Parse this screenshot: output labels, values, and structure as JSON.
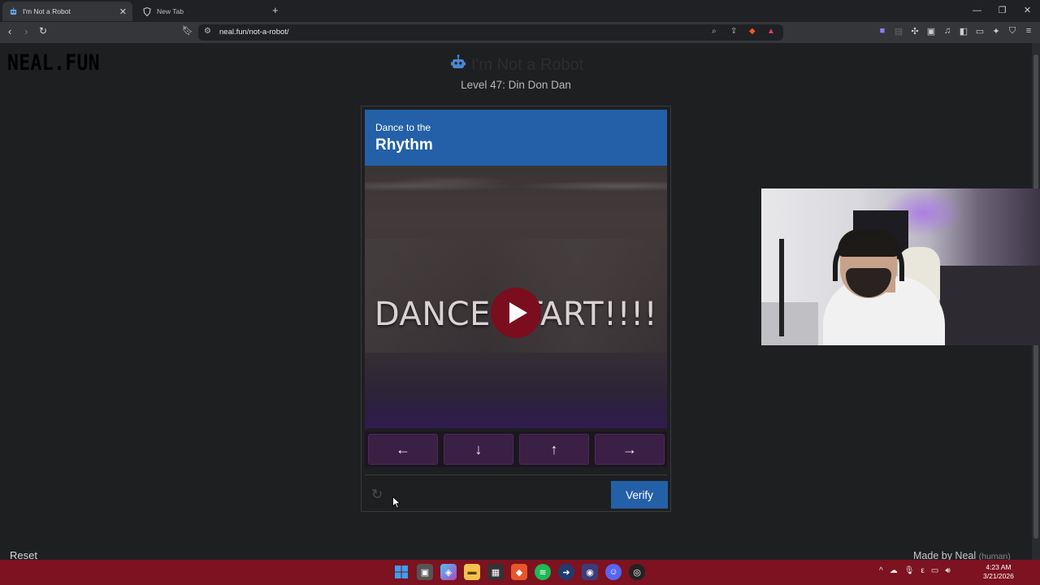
{
  "browser": {
    "tabs": [
      {
        "label": "I'm Not a Robot",
        "active": true
      },
      {
        "label": "New Tab",
        "active": false
      }
    ],
    "new_tab": "+",
    "window_controls": [
      "—",
      "❐",
      "✕"
    ],
    "url": "neal.fun/not-a-robot/"
  },
  "site": {
    "logo": "NEAL.FUN",
    "title": "I'm Not a Robot",
    "level": "Level 47: Din Don Dan"
  },
  "captcha": {
    "header_sub": "Dance to the",
    "header_main": "Rhythm",
    "video_text": "DANCE START!!!!",
    "arrows": [
      "←",
      "↓",
      "↑",
      "→"
    ],
    "verify_label": "Verify"
  },
  "footer": {
    "reset": "Reset",
    "made_by": "Made by Neal",
    "made_by_note": "(human)"
  },
  "taskbar": {
    "time": "4:23 AM",
    "date": "3/21/2026"
  },
  "colors": {
    "accent_blue": "#2460a7",
    "play_button": "#7a0e1e",
    "arrow_button": "#3b1f45",
    "taskbar": "#7d1220"
  }
}
